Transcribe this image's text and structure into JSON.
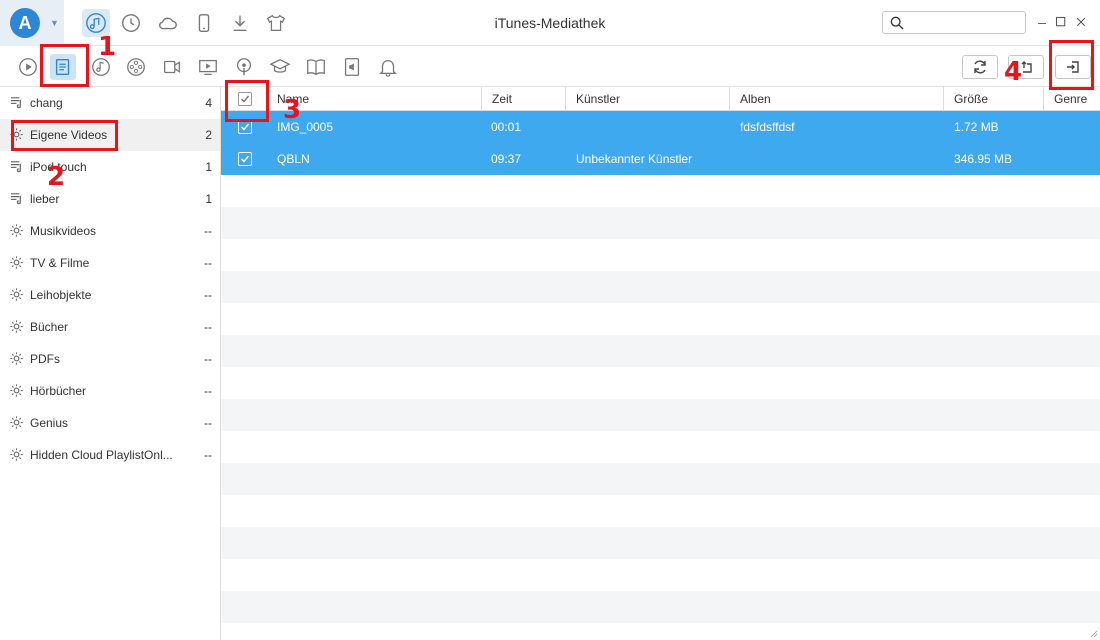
{
  "app": {
    "title": "iTunes-Mediathek",
    "logo_letter": "A",
    "top_icons": [
      "music-note-icon",
      "history-icon",
      "cloud-icon",
      "phone-icon",
      "download-icon",
      "tshirt-icon"
    ],
    "search": {
      "placeholder": "",
      "value": ""
    }
  },
  "toolbar": {
    "icons": [
      "play-icon",
      "playlist-icon",
      "music-icon",
      "film-reel-icon",
      "video-camera-icon",
      "tv-icon",
      "podcast-icon",
      "graduation-cap-icon",
      "book-icon",
      "audiobook-icon",
      "bell-icon"
    ],
    "refresh_icon": "refresh-icon",
    "to_device_icon": "export-to-device-icon",
    "to_pc_icon": "export-to-pc-icon"
  },
  "sidebar": {
    "items": [
      {
        "label": "chang",
        "count": "4",
        "icon": "playlist-icon"
      },
      {
        "label": "Eigene Videos",
        "count": "2",
        "icon": "gear-icon",
        "selected": true
      },
      {
        "label": "iPod touch",
        "count": "1",
        "icon": "playlist-icon"
      },
      {
        "label": "lieber",
        "count": "1",
        "icon": "playlist-icon"
      },
      {
        "label": "Musikvideos",
        "count": "--",
        "icon": "gear-icon"
      },
      {
        "label": "TV & Filme",
        "count": "--",
        "icon": "gear-icon"
      },
      {
        "label": "Leihobjekte",
        "count": "--",
        "icon": "gear-icon"
      },
      {
        "label": "Bücher",
        "count": "--",
        "icon": "gear-icon"
      },
      {
        "label": "PDFs",
        "count": "--",
        "icon": "gear-icon"
      },
      {
        "label": "Hörbücher",
        "count": "--",
        "icon": "gear-icon"
      },
      {
        "label": "Genius",
        "count": "--",
        "icon": "gear-icon"
      },
      {
        "label": "Hidden Cloud PlaylistOnl...",
        "count": "--",
        "icon": "gear-icon"
      }
    ]
  },
  "table": {
    "headers": [
      "Name",
      "Zeit",
      "Künstler",
      "Alben",
      "Größe",
      "Genre"
    ],
    "rows": [
      {
        "name": "IMG_0005",
        "zeit": "00:01",
        "kuenstler": "",
        "alben": "fdsfdsffdsf",
        "groesse": "1.72 MB",
        "genre": "",
        "checked": true
      },
      {
        "name": "QBLN",
        "zeit": "09:37",
        "kuenstler": "Unbekannter Künstler",
        "alben": "",
        "groesse": "346.95 MB",
        "genre": "",
        "checked": true
      }
    ]
  },
  "annotations": {
    "labels": [
      "1",
      "2",
      "3",
      "4"
    ],
    "color": "#e8141a"
  },
  "colors": {
    "selection": "#3fa9f0",
    "accent": "#2e86d9",
    "alt_row": "#f4f5f7"
  }
}
